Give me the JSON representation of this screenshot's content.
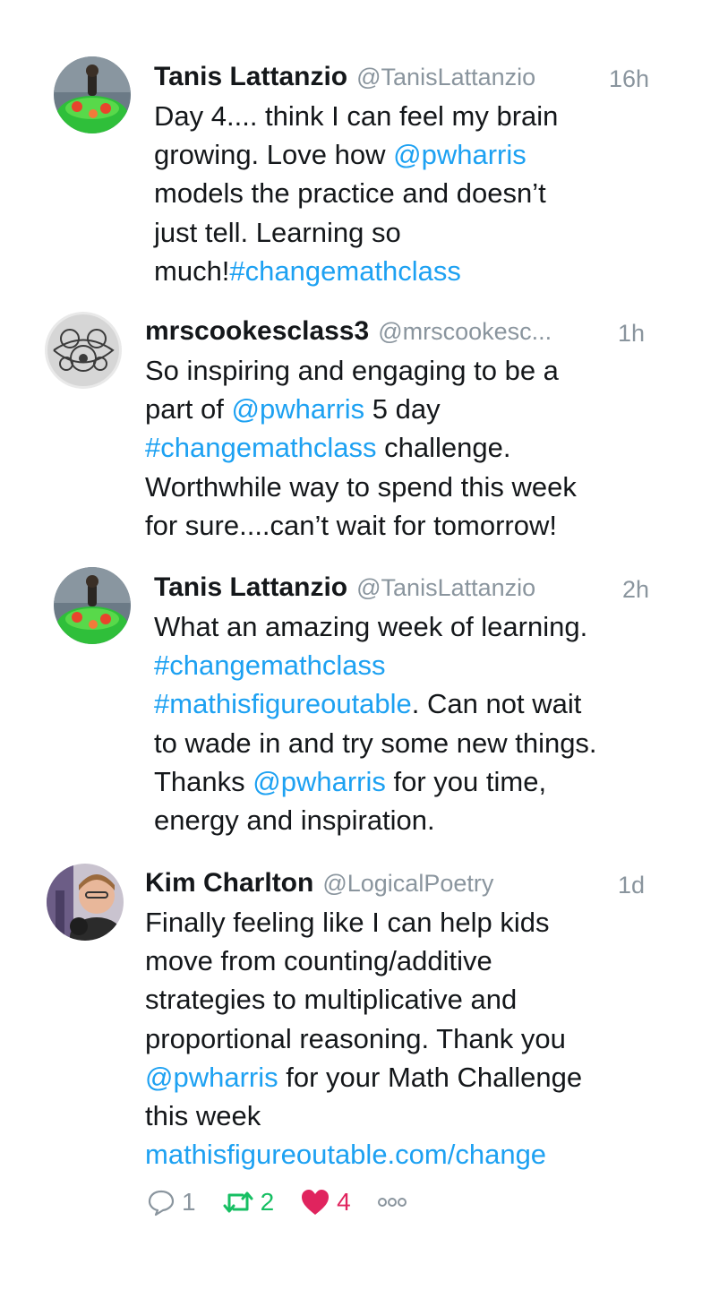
{
  "tweets": [
    {
      "name": "Tanis Lattanzio",
      "handle": "@TanisLattanzio",
      "time": "16h",
      "lines": [
        [
          {
            "t": "Day 4.... think I can feel my brain",
            "link": false
          }
        ],
        [
          {
            "t": "growing. Love how ",
            "link": false
          },
          {
            "t": "@pwharris",
            "link": true
          }
        ],
        [
          {
            "t": "models the practice and doesn’t",
            "link": false
          }
        ],
        [
          {
            "t": "just tell. Learning so",
            "link": false
          }
        ],
        [
          {
            "t": "much!",
            "link": false
          },
          {
            "t": "#changemathclass",
            "link": true
          }
        ]
      ]
    },
    {
      "name": "mrscookesclass3",
      "handle": "@mrscookesc...",
      "time": "1h",
      "lines": [
        [
          {
            "t": "So inspiring and engaging to be a",
            "link": false
          }
        ],
        [
          {
            "t": "part of ",
            "link": false
          },
          {
            "t": "@pwharris",
            "link": true
          },
          {
            "t": " 5 day",
            "link": false
          }
        ],
        [
          {
            "t": "#changemathclass",
            "link": true
          },
          {
            "t": " challenge.",
            "link": false
          }
        ],
        [
          {
            "t": "Worthwhile way to spend this week",
            "link": false
          }
        ],
        [
          {
            "t": "for sure....can’t wait for tomorrow!",
            "link": false
          }
        ]
      ]
    },
    {
      "name": "Tanis Lattanzio",
      "handle": "@TanisLattanzio",
      "time": "2h",
      "lines": [
        [
          {
            "t": "What an amazing week of learning.",
            "link": false
          }
        ],
        [
          {
            "t": "#changemathclass",
            "link": true
          }
        ],
        [
          {
            "t": "#mathisfigureoutable",
            "link": true
          },
          {
            "t": ". Can not wait",
            "link": false
          }
        ],
        [
          {
            "t": "to wade in and try some new things.",
            "link": false
          }
        ],
        [
          {
            "t": "Thanks ",
            "link": false
          },
          {
            "t": "@pwharris",
            "link": true
          },
          {
            "t": " for you time,",
            "link": false
          }
        ],
        [
          {
            "t": "energy and inspiration.",
            "link": false
          }
        ]
      ]
    },
    {
      "name": "Kim Charlton",
      "handle": "@LogicalPoetry",
      "time": "1d",
      "lines": [
        [
          {
            "t": "Finally feeling like I can help kids",
            "link": false
          }
        ],
        [
          {
            "t": "move from counting/additive",
            "link": false
          }
        ],
        [
          {
            "t": "strategies to multiplicative and",
            "link": false
          }
        ],
        [
          {
            "t": "proportional reasoning. Thank you",
            "link": false
          }
        ],
        [
          {
            "t": "@pwharris",
            "link": true
          },
          {
            "t": " for your Math Challenge",
            "link": false
          }
        ],
        [
          {
            "t": "this week",
            "link": false
          }
        ],
        [
          {
            "t": "mathisfigureoutable.com/change",
            "link": true
          }
        ]
      ],
      "actions": {
        "reply_count": "1",
        "retweet_count": "2",
        "like_count": "4"
      }
    }
  ],
  "colors": {
    "link": "#1da1f2",
    "retweet": "#17bf63",
    "like": "#e0245e",
    "muted": "#8a959e"
  },
  "icons": [
    "reply-icon",
    "retweet-icon",
    "heart-icon",
    "more-icon"
  ]
}
